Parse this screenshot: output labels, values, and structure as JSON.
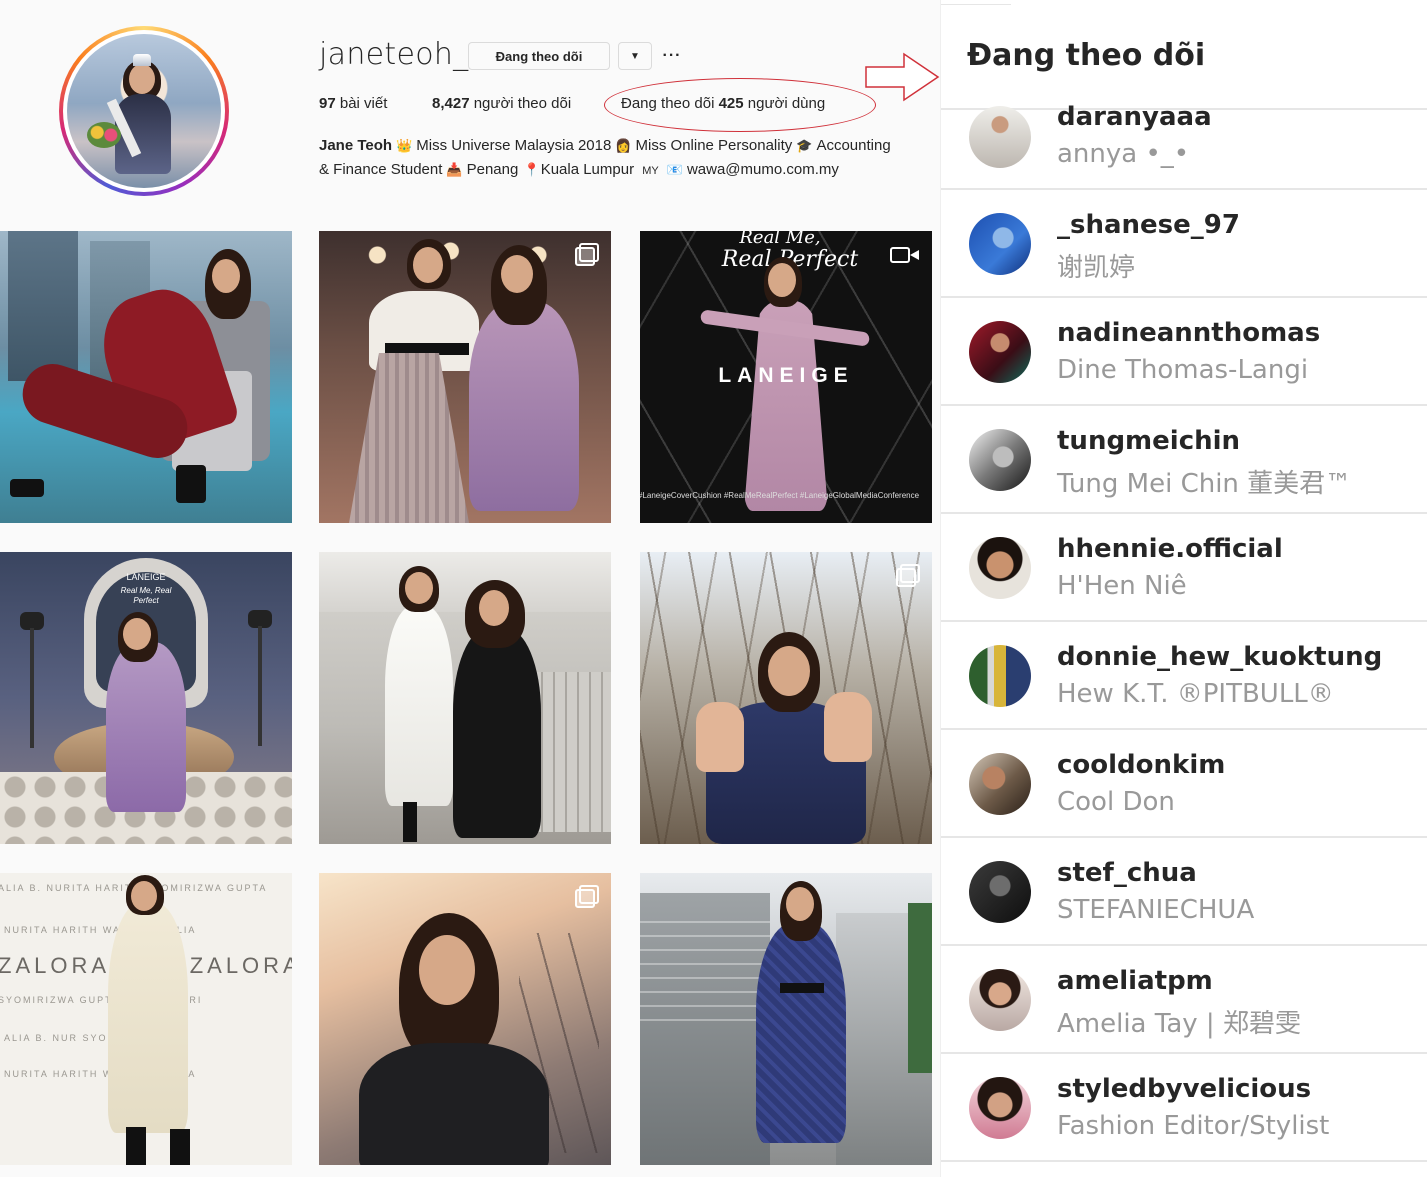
{
  "profile": {
    "username": "janeteoh_",
    "following_button_label": "Đang theo dõi",
    "dropdown_glyph": "▼",
    "more_glyph": "···",
    "stats": {
      "posts_count": "97",
      "posts_label": "bài viết",
      "followers_count": "8,427",
      "followers_label": "người theo dõi",
      "following_prefix": "Đang theo dõi",
      "following_count": "425",
      "following_suffix": "người dùng"
    },
    "bio": {
      "name": "Jane Teoh",
      "line1_text_a": "Miss Universe Malaysia 2018",
      "line1_text_b": "Miss Online Personality",
      "line1_text_c": "Accounting",
      "line2_text_a": "& Finance Student",
      "line2_text_b": "Penang",
      "line2_text_c": "Kuala Lumpur",
      "line2_flag": "MY",
      "line2_text_d": "wawa@mumo.com.my",
      "emoji_crown": "👑",
      "emoji_woman": "👩",
      "emoji_grad": "🎓",
      "emoji_inbox": "📥",
      "emoji_pin": "📍",
      "emoji_mail": "📧"
    }
  },
  "posts": {
    "post2_multi_icon": "multiple-photos-icon",
    "post3_overlay_top": "Real Me,",
    "post3_overlay_script": "Real Perfect",
    "post3_brand": "LANEIGE",
    "post3_caption": "#LaneigeCoverCushion #RealMeRealPerfect #LaneigeGlobalMediaConference",
    "post4_sign": "LANEIGE",
    "post4_sign_script": "Real Me, Real Perfect",
    "post7_wall_row1": "ALIA B.   NURITA HARITH   SYOMIRIZWA GUPTA",
    "post7_wall_row2": "NURITA HARITH    WA GUPTA   ALIA",
    "post7_wall_row3": "ZALORA        ZALORA",
    "post7_wall_row4": "SYOMIRIZWA GUPTA   NURITA HARI",
    "post7_wall_row5": "ALIA B.   NUR   SYOMIRIZWA GUP",
    "post7_wall_row6": "NURITA HARITH   WA GUPTA   ALIA"
  },
  "following_panel": {
    "title": "Đang theo dõi",
    "users": [
      {
        "username": "daranyaaa",
        "fullname": "annya •_•"
      },
      {
        "username": "_shanese_97",
        "fullname": "谢凯婷"
      },
      {
        "username": "nadineannthomas",
        "fullname": "Dine Thomas-Langi"
      },
      {
        "username": "tungmeichin",
        "fullname": "Tung Mei Chin 董美君™"
      },
      {
        "username": "hhennie.official",
        "fullname": "H'Hen Niê"
      },
      {
        "username": "donnie_hew_kuoktung",
        "fullname": "Hew K.T. ®PITBULL®"
      },
      {
        "username": "cooldonkim",
        "fullname": "Cool Don"
      },
      {
        "username": "stef_chua",
        "fullname": "STEFANIECHUA"
      },
      {
        "username": "ameliatpm",
        "fullname": "Amelia Tay | 郑碧雯"
      },
      {
        "username": "styledbyvelicious",
        "fullname": "Fashion Editor/Stylist"
      }
    ]
  },
  "colors": {
    "annotation_red": "#d0313a",
    "text_primary": "#262626",
    "text_secondary": "#999999"
  }
}
